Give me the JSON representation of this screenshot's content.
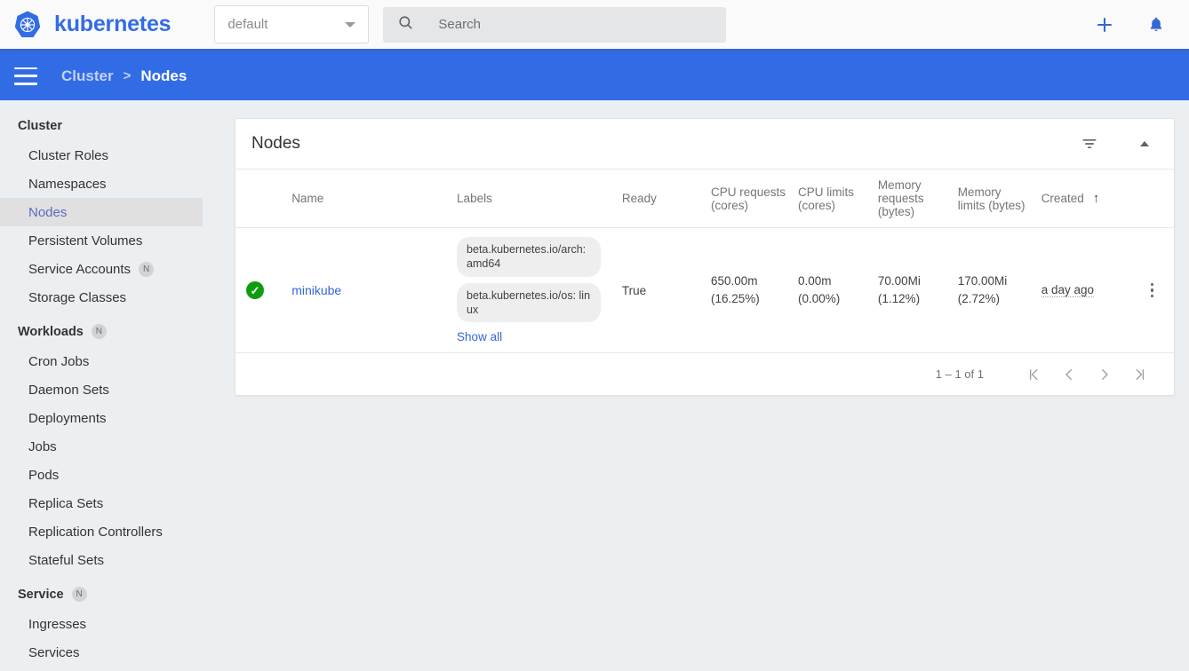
{
  "topbar": {
    "brand": "kubernetes",
    "logo_icon": "kubernetes-logo",
    "namespace_selected": "default",
    "namespace_caret_icon": "chevron-down-icon",
    "search_icon": "search-icon",
    "search_placeholder": "Search",
    "search_value": "",
    "create_icon": "plus-icon",
    "notifications_icon": "bell-icon",
    "accent_color": "#326ce5"
  },
  "breadcrumb": {
    "menu_icon": "hamburger-menu-icon",
    "parent": "Cluster",
    "separator": ">",
    "current": "Nodes",
    "bar_color": "#326ce5"
  },
  "sidebar": {
    "groups": [
      {
        "title": "Cluster",
        "badge": "",
        "items": [
          {
            "label": "Cluster Roles",
            "badge": "",
            "active": false
          },
          {
            "label": "Namespaces",
            "badge": "",
            "active": false
          },
          {
            "label": "Nodes",
            "badge": "",
            "active": true
          },
          {
            "label": "Persistent Volumes",
            "badge": "",
            "active": false
          },
          {
            "label": "Service Accounts",
            "badge": "N",
            "active": false
          },
          {
            "label": "Storage Classes",
            "badge": "",
            "active": false
          }
        ]
      },
      {
        "title": "Workloads",
        "badge": "N",
        "items": [
          {
            "label": "Cron Jobs",
            "badge": "",
            "active": false
          },
          {
            "label": "Daemon Sets",
            "badge": "",
            "active": false
          },
          {
            "label": "Deployments",
            "badge": "",
            "active": false
          },
          {
            "label": "Jobs",
            "badge": "",
            "active": false
          },
          {
            "label": "Pods",
            "badge": "",
            "active": false
          },
          {
            "label": "Replica Sets",
            "badge": "",
            "active": false
          },
          {
            "label": "Replication Controllers",
            "badge": "",
            "active": false
          },
          {
            "label": "Stateful Sets",
            "badge": "",
            "active": false
          }
        ]
      },
      {
        "title": "Service",
        "badge": "N",
        "items": [
          {
            "label": "Ingresses",
            "badge": "",
            "active": false
          },
          {
            "label": "Services",
            "badge": "",
            "active": false
          }
        ]
      }
    ]
  },
  "card": {
    "title": "Nodes",
    "filter_icon": "filter-icon",
    "collapse_icon": "chevron-up-icon"
  },
  "table": {
    "columns": [
      {
        "key": "status",
        "label": ""
      },
      {
        "key": "name",
        "label": "Name"
      },
      {
        "key": "labels",
        "label": "Labels"
      },
      {
        "key": "ready",
        "label": "Ready"
      },
      {
        "key": "cpu_requests",
        "label": "CPU requests (cores)"
      },
      {
        "key": "cpu_limits",
        "label": "CPU limits (cores)"
      },
      {
        "key": "memory_requests",
        "label": "Memory requests (bytes)"
      },
      {
        "key": "memory_limits",
        "label": "Memory limits (bytes)"
      },
      {
        "key": "created",
        "label": "Created"
      },
      {
        "key": "actions",
        "label": ""
      }
    ],
    "sorted_column": "Created",
    "sort_direction_icon": "arrow-up-icon",
    "rows": [
      {
        "status": "ok",
        "status_icon": "check-circle-icon",
        "name": "minikube",
        "labels": [
          "beta.kubernetes.io/arch: amd64",
          "beta.kubernetes.io/os: linux"
        ],
        "show_all_label": "Show all",
        "ready": "True",
        "cpu_requests_value": "650.00m",
        "cpu_requests_percent": "(16.25%)",
        "cpu_limits_value": "0.00m",
        "cpu_limits_percent": "(0.00%)",
        "memory_requests_value": "70.00Mi",
        "memory_requests_percent": "(1.12%)",
        "memory_limits_value": "170.00Mi",
        "memory_limits_percent": "(2.72%)",
        "created": "a day ago",
        "actions_icon": "kebab-menu-icon"
      }
    ]
  },
  "paginator": {
    "range_label": "1 – 1 of 1",
    "first_page_icon": "first-page-icon",
    "prev_page_icon": "previous-page-icon",
    "next_page_icon": "next-page-icon",
    "last_page_icon": "last-page-icon"
  }
}
